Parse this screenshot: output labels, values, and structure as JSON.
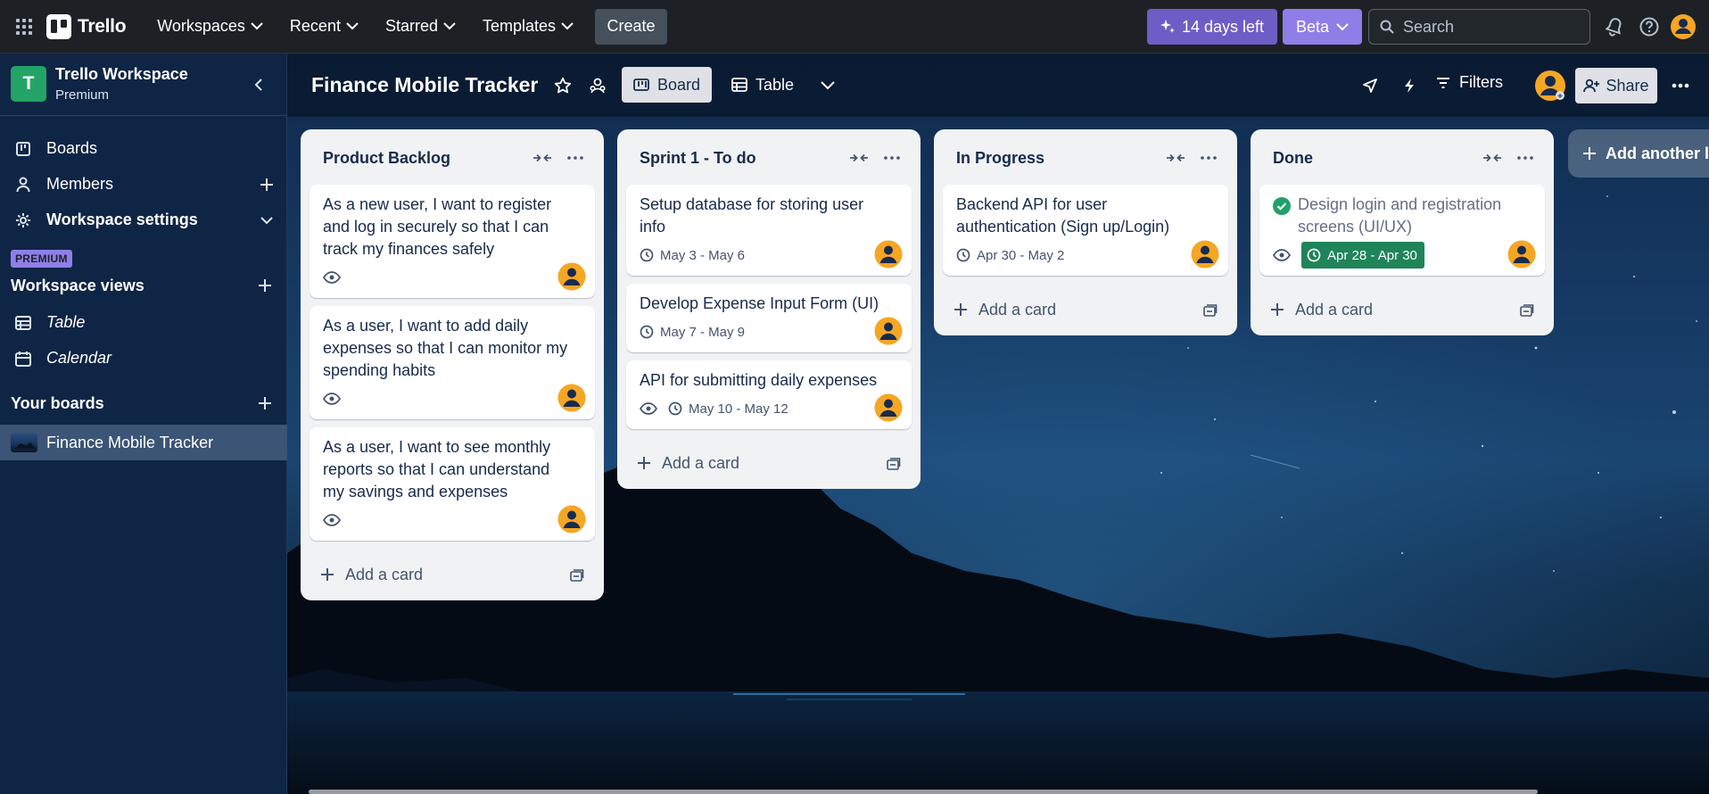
{
  "topbar": {
    "brand": "Trello",
    "nav": [
      {
        "label": "Workspaces"
      },
      {
        "label": "Recent"
      },
      {
        "label": "Starred"
      },
      {
        "label": "Templates"
      }
    ],
    "create_label": "Create",
    "trial_label": "14 days left",
    "beta_label": "Beta",
    "search_placeholder": "Search",
    "icons": [
      "app-switcher-icon",
      "notifications-icon",
      "help-icon",
      "account-avatar"
    ]
  },
  "sidebar": {
    "workspace_name": "Trello Workspace",
    "workspace_plan": "Premium",
    "workspace_initial": "T",
    "items": [
      {
        "label": "Boards",
        "icon": "boards-icon"
      },
      {
        "label": "Members",
        "icon": "members-icon"
      },
      {
        "label": "Workspace settings",
        "icon": "gear-icon"
      }
    ],
    "premium_badge": "PREMIUM",
    "views_heading": "Workspace views",
    "views": [
      {
        "label": "Table",
        "icon": "table-icon"
      },
      {
        "label": "Calendar",
        "icon": "calendar-icon"
      }
    ],
    "boards_heading": "Your boards",
    "boards": [
      {
        "label": "Finance Mobile Tracker"
      }
    ]
  },
  "board": {
    "title": "Finance Mobile Tracker",
    "views": [
      {
        "label": "Board",
        "active": true
      },
      {
        "label": "Table",
        "active": false
      }
    ],
    "filters_label": "Filters",
    "share_label": "Share",
    "add_list_label": "Add another li"
  },
  "lists": [
    {
      "title": "Product Backlog",
      "add_label": "Add a card",
      "cards": [
        {
          "title": "As a new user, I want to register and log in securely so that I can track my finances safely",
          "watch": true
        },
        {
          "title": "As a user, I want to add daily expenses so that I can monitor my spending habits",
          "watch": true
        },
        {
          "title": "As a user, I want to see monthly reports so that I can understand my savings and expenses",
          "watch": true
        }
      ]
    },
    {
      "title": "Sprint 1 - To do",
      "add_label": "Add a card",
      "cards": [
        {
          "title": "Setup database for storing user info",
          "date": "May 3 - May 6"
        },
        {
          "title": "Develop Expense Input Form (UI)",
          "date": "May 7 - May 9"
        },
        {
          "title": "API for submitting daily expenses",
          "watch": true,
          "date": "May 10 - May 12"
        }
      ]
    },
    {
      "title": "In Progress",
      "add_label": "Add a card",
      "cards": [
        {
          "title": "Backend API for user authentication (Sign up/Login)",
          "date": "Apr 30 - May 2"
        }
      ]
    },
    {
      "title": "Done",
      "add_label": "Add a card",
      "cards": [
        {
          "title": "Design login and registration screens (UI/UX)",
          "watch": true,
          "date": "Apr 28 - Apr 30",
          "complete": true
        }
      ]
    }
  ],
  "colors": {
    "header_bg": "#1d2125",
    "sidebar_bg": "#0f2545",
    "list_bg": "#f1f2f4",
    "trial_purple": "#6e5dc6",
    "beta_purple": "#8f7ee7",
    "complete_green": "#1f845a",
    "avatar_orange": "#f5a623",
    "workspace_green": "#23a466"
  }
}
